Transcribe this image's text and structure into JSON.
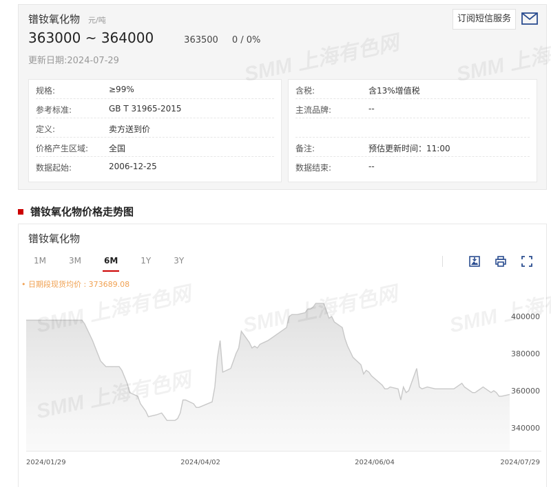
{
  "info": {
    "title": "镨钕氧化物",
    "unit": "元/吨",
    "price_range": "363000 ~ 364000",
    "mid_price": "363500",
    "change": "0 / 0%",
    "update_label": "更新日期:",
    "update_date": "2024-07-29",
    "sms_button": "订阅短信服务",
    "left_specs": [
      {
        "key": "规格:",
        "value": "≥99%"
      },
      {
        "key": "参考标准:",
        "value": "GB T 31965-2015"
      },
      {
        "key": "定义:",
        "value": "卖方送到价"
      },
      {
        "key": "价格产生区域:",
        "value": "全国"
      },
      {
        "key": "数据起始:",
        "value": "2006-12-25"
      }
    ],
    "right_specs": [
      {
        "key": "含税:",
        "value": "含13%增值税"
      },
      {
        "key": "主流品牌:",
        "value": "--"
      },
      {
        "key": "",
        "value": ""
      },
      {
        "key": "备注:",
        "value": "预估更新时间：11:00"
      },
      {
        "key": "数据结束:",
        "value": "--"
      }
    ]
  },
  "section": {
    "title": "镨钕氧化物价格走势图"
  },
  "chart": {
    "title": "镨钕氧化物",
    "tabs": [
      "1M",
      "3M",
      "6M",
      "1Y",
      "3Y"
    ],
    "active_tab": "6M",
    "avg_label": "• 日期段现货均价 : 373689.08",
    "tools": [
      "download-image-icon",
      "print-icon",
      "fullscreen-icon"
    ]
  },
  "watermarks": [
    "SMM 上海有色网"
  ],
  "colors": {
    "accent": "#cc0000",
    "avg_text": "#f0a050",
    "line": "#c8c8c8"
  },
  "chart_data": {
    "type": "area",
    "x_ticks": [
      "2024/01/29",
      "2024/04/02",
      "2024/06/04",
      "2024/07/29"
    ],
    "y_ticks": [
      340000,
      360000,
      380000,
      400000
    ],
    "ylim": [
      334000,
      416000
    ],
    "x_range": [
      "2024-01-29",
      "2024-07-29"
    ],
    "series": [
      {
        "values": [
          [
            "2024-01-29",
            398000
          ],
          [
            "2024-02-19",
            398000
          ],
          [
            "2024-02-20",
            396000
          ],
          [
            "2024-02-23",
            387000
          ],
          [
            "2024-02-26",
            376000
          ],
          [
            "2024-02-28",
            373000
          ],
          [
            "2024-03-04",
            373000
          ],
          [
            "2024-03-05",
            371000
          ],
          [
            "2024-03-07",
            364000
          ],
          [
            "2024-03-08",
            359000
          ],
          [
            "2024-03-11",
            357000
          ],
          [
            "2024-03-12",
            353000
          ],
          [
            "2024-03-14",
            349000
          ],
          [
            "2024-03-15",
            346000
          ],
          [
            "2024-03-18",
            347000
          ],
          [
            "2024-03-20",
            348000
          ],
          [
            "2024-03-21",
            346000
          ],
          [
            "2024-03-22",
            344000
          ],
          [
            "2024-03-25",
            344000
          ],
          [
            "2024-03-26",
            345000
          ],
          [
            "2024-03-27",
            348000
          ],
          [
            "2024-03-28",
            355000
          ],
          [
            "2024-03-29",
            355000
          ],
          [
            "2024-04-01",
            353000
          ],
          [
            "2024-04-02",
            351000
          ],
          [
            "2024-04-03",
            351000
          ],
          [
            "2024-04-08",
            354000
          ],
          [
            "2024-04-09",
            362000
          ],
          [
            "2024-04-10",
            378000
          ],
          [
            "2024-04-11",
            387000
          ],
          [
            "2024-04-12",
            370000
          ],
          [
            "2024-04-15",
            372000
          ],
          [
            "2024-04-16",
            376000
          ],
          [
            "2024-04-17",
            380000
          ],
          [
            "2024-04-18",
            383000
          ],
          [
            "2024-04-19",
            392000
          ],
          [
            "2024-04-22",
            386000
          ],
          [
            "2024-04-23",
            383000
          ],
          [
            "2024-04-24",
            384000
          ],
          [
            "2024-04-25",
            383000
          ],
          [
            "2024-04-26",
            385000
          ],
          [
            "2024-04-29",
            387000
          ],
          [
            "2024-04-30",
            388000
          ],
          [
            "2024-05-06",
            394000
          ],
          [
            "2024-05-07",
            400000
          ],
          [
            "2024-05-08",
            401000
          ],
          [
            "2024-05-09",
            401000
          ],
          [
            "2024-05-10",
            401000
          ],
          [
            "2024-05-13",
            402000
          ],
          [
            "2024-05-14",
            404000
          ],
          [
            "2024-05-15",
            404000
          ],
          [
            "2024-05-16",
            405000
          ],
          [
            "2024-05-17",
            407000
          ],
          [
            "2024-05-20",
            407000
          ],
          [
            "2024-05-21",
            403000
          ],
          [
            "2024-05-22",
            399000
          ],
          [
            "2024-05-23",
            400000
          ],
          [
            "2024-05-24",
            397000
          ],
          [
            "2024-05-27",
            394000
          ],
          [
            "2024-05-28",
            388000
          ],
          [
            "2024-05-29",
            384000
          ],
          [
            "2024-05-30",
            381000
          ],
          [
            "2024-05-31",
            378000
          ],
          [
            "2024-06-03",
            374000
          ],
          [
            "2024-06-04",
            369000
          ],
          [
            "2024-06-05",
            371000
          ],
          [
            "2024-06-06",
            370000
          ],
          [
            "2024-06-07",
            368000
          ],
          [
            "2024-06-11",
            363000
          ],
          [
            "2024-06-12",
            361000
          ],
          [
            "2024-06-13",
            361000
          ],
          [
            "2024-06-14",
            362000
          ],
          [
            "2024-06-17",
            361000
          ],
          [
            "2024-06-18",
            355000
          ],
          [
            "2024-06-19",
            362000
          ],
          [
            "2024-06-20",
            359000
          ],
          [
            "2024-06-21",
            360000
          ],
          [
            "2024-06-24",
            372000
          ],
          [
            "2024-06-25",
            362000
          ],
          [
            "2024-06-26",
            361000
          ],
          [
            "2024-06-28",
            362000
          ],
          [
            "2024-07-01",
            361000
          ],
          [
            "2024-07-03",
            361000
          ],
          [
            "2024-07-05",
            361000
          ],
          [
            "2024-07-08",
            361000
          ],
          [
            "2024-07-10",
            363000
          ],
          [
            "2024-07-11",
            364000
          ],
          [
            "2024-07-12",
            362000
          ],
          [
            "2024-07-15",
            359000
          ],
          [
            "2024-07-16",
            359000
          ],
          [
            "2024-07-17",
            360000
          ],
          [
            "2024-07-18",
            361000
          ],
          [
            "2024-07-19",
            362000
          ],
          [
            "2024-07-22",
            359000
          ],
          [
            "2024-07-23",
            360000
          ],
          [
            "2024-07-24",
            359000
          ],
          [
            "2024-07-25",
            357000
          ],
          [
            "2024-07-26",
            357000
          ],
          [
            "2024-07-29",
            358000
          ]
        ]
      }
    ],
    "grid": false,
    "legend": "none"
  }
}
